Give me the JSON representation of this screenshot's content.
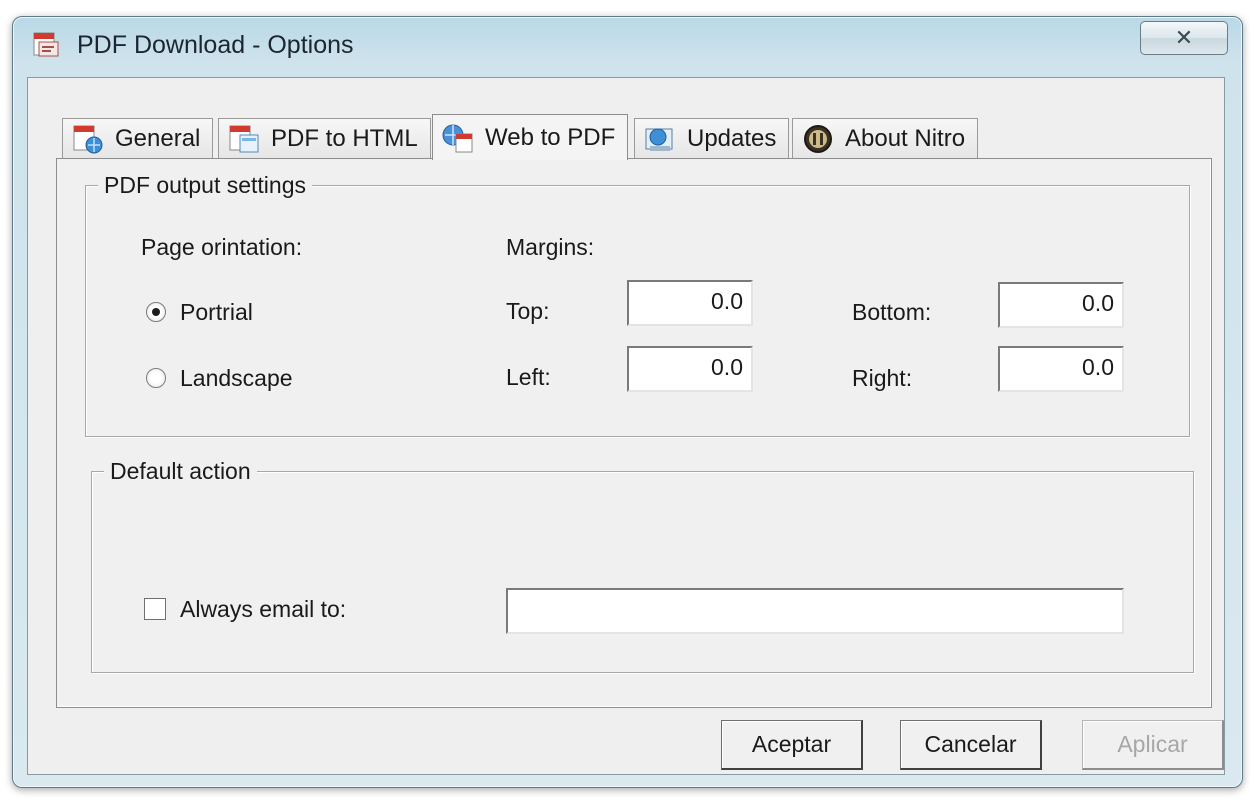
{
  "window": {
    "title": "PDF Download - Options",
    "close_label": "✕"
  },
  "tabs": [
    {
      "label": "General",
      "icon": "general-icon"
    },
    {
      "label": "PDF to HTML",
      "icon": "pdf-to-html-icon"
    },
    {
      "label": "Web to PDF",
      "icon": "web-to-pdf-icon",
      "selected": true
    },
    {
      "label": "Updates",
      "icon": "updates-icon"
    },
    {
      "label": "About Nitro",
      "icon": "nitro-icon"
    }
  ],
  "pdf_output": {
    "legend": "PDF output settings",
    "orientation_label": "Page orintation:",
    "options": [
      {
        "label": "Portrial",
        "checked": true
      },
      {
        "label": "Landscape",
        "checked": false
      }
    ],
    "margins_label": "Margins:",
    "margins": {
      "top_label": "Top:",
      "top_value": "0.0",
      "bottom_label": "Bottom:",
      "bottom_value": "0.0",
      "left_label": "Left:",
      "left_value": "0.0",
      "right_label": "Right:",
      "right_value": "0.0"
    }
  },
  "default_action": {
    "legend": "Default action",
    "always_email_label": "Always email to:",
    "always_email_checked": false,
    "email_value": ""
  },
  "buttons": {
    "ok": "Aceptar",
    "cancel": "Cancelar",
    "apply": "Aplicar"
  }
}
